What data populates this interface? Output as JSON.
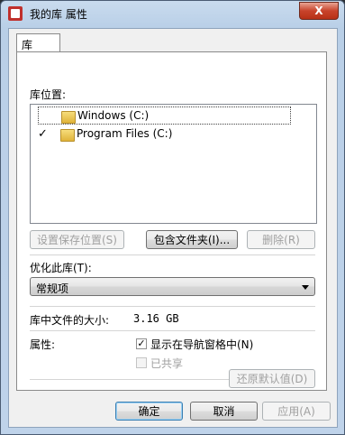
{
  "window": {
    "title": "我的库 属性",
    "close_glyph": "X"
  },
  "tab": {
    "label": "库"
  },
  "locations": {
    "label": "库位置:",
    "items": [
      {
        "label": "Windows (C:)",
        "check": ""
      },
      {
        "label": "Program Files (C:)",
        "check": "✓"
      }
    ]
  },
  "location_buttons": {
    "set_save": "设置保存位置(S)",
    "include_folder": "包含文件夹(I)...",
    "remove": "删除(R)"
  },
  "optimize": {
    "label": "优化此库(T):",
    "selected": "常规项"
  },
  "size": {
    "label": "库中文件的大小:",
    "value": "3.16 GB"
  },
  "attributes": {
    "label": "属性:",
    "show_in_nav": {
      "label": "显示在导航窗格中(N)",
      "checked": "✓"
    },
    "shared": {
      "label": "已共享",
      "checked": ""
    }
  },
  "restore_defaults": "还原默认值(D)",
  "footer": {
    "ok": "确定",
    "cancel": "取消",
    "apply": "应用(A)"
  }
}
